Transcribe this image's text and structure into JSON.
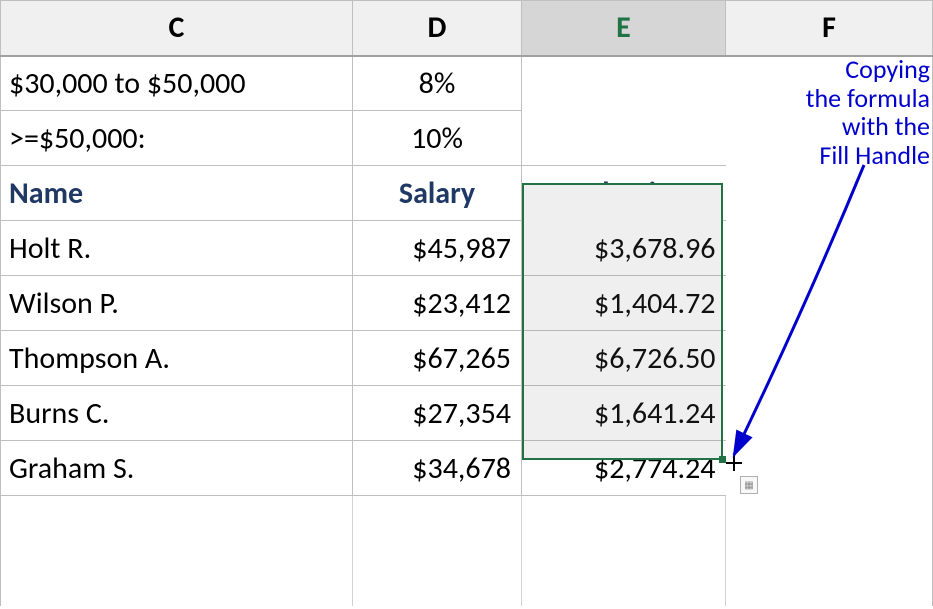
{
  "columns": {
    "c": "C",
    "d": "D",
    "e": "E",
    "f": "F"
  },
  "rules": {
    "r1": {
      "label": "$30,000 to $50,000",
      "pct": "8%"
    },
    "r2": {
      "label": ">=$50,000:",
      "pct": "10%"
    }
  },
  "headers": {
    "name": "Name",
    "salary": "Salary",
    "deduction": "Deduction"
  },
  "rows": [
    {
      "name": "Holt R.",
      "salary": "$45,987",
      "deduction": "$3,678.96"
    },
    {
      "name": "Wilson P.",
      "salary": "$23,412",
      "deduction": "$1,404.72"
    },
    {
      "name": "Thompson A.",
      "salary": "$67,265",
      "deduction": "$6,726.50"
    },
    {
      "name": "Burns C.",
      "salary": "$27,354",
      "deduction": "$1,641.24"
    },
    {
      "name": "Graham S.",
      "salary": "$34,678",
      "deduction": "$2,774.24"
    }
  ],
  "caption": {
    "l1": "Copying",
    "l2": "the formula",
    "l3": "with the",
    "l4": "Fill Handle"
  },
  "chart_data": {
    "type": "table",
    "rules": [
      {
        "range": "$30,000 to $50,000",
        "rate_pct": 8
      },
      {
        "range": ">=$50,000",
        "rate_pct": 10
      }
    ],
    "columns": [
      "Name",
      "Salary",
      "Deduction"
    ],
    "rows": [
      {
        "Name": "Holt R.",
        "Salary": 45987,
        "Deduction": 3678.96
      },
      {
        "Name": "Wilson P.",
        "Salary": 23412,
        "Deduction": 1404.72
      },
      {
        "Name": "Thompson A.",
        "Salary": 67265,
        "Deduction": 6726.5
      },
      {
        "Name": "Burns C.",
        "Salary": 27354,
        "Deduction": 1641.24
      },
      {
        "Name": "Graham S.",
        "Salary": 34678,
        "Deduction": 2774.24
      }
    ]
  }
}
